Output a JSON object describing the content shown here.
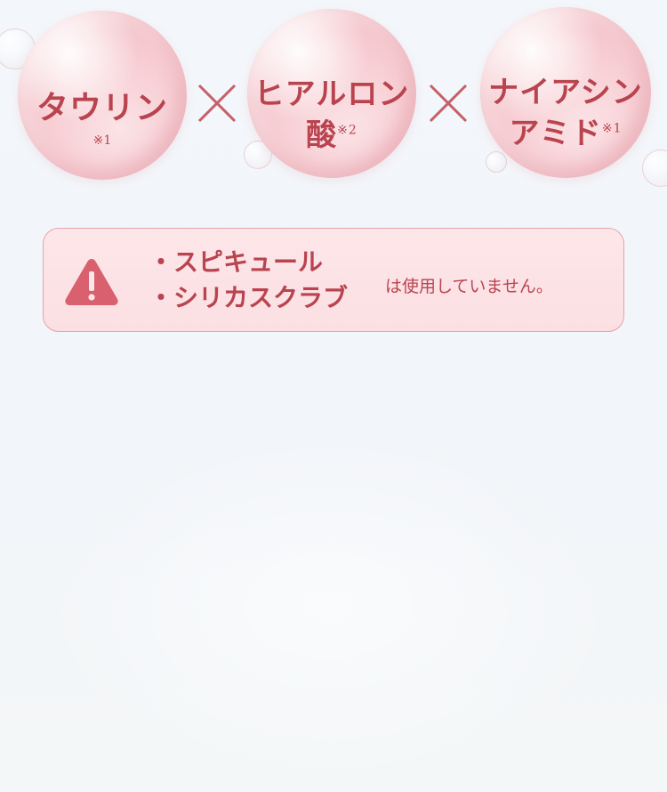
{
  "ingredients": [
    {
      "name": "タウリン",
      "note": "※1"
    },
    {
      "name_line1": "ヒアルロン",
      "name_line2": "酸",
      "note": "※2"
    },
    {
      "name_line1": "ナイアシン",
      "name_line2": "アミド",
      "note": "※1"
    }
  ],
  "warning": {
    "items": [
      "・スピキュール",
      "・シリカスクラブ"
    ],
    "suffix": "は使用していません。"
  },
  "colors": {
    "accent": "#b9444f",
    "box_border": "#e7a2ab",
    "box_background": "#fbe0e4",
    "icon": "#d9606e"
  },
  "icons": {
    "warning": "warning-triangle-icon",
    "times": "multiply-cross-icon"
  }
}
